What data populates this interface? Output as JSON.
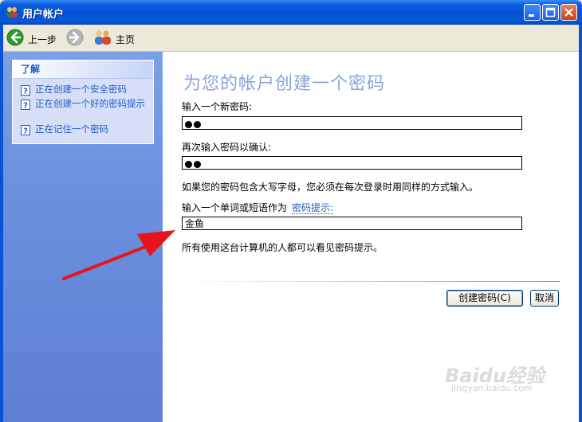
{
  "window": {
    "title": "用户帐户",
    "accent": "#0a53d6"
  },
  "toolbar": {
    "back_label": "上一步",
    "home_label": "主页"
  },
  "sidebar": {
    "heading": "了解",
    "items": [
      {
        "label": "正在创建一个安全密码"
      },
      {
        "label": "正在创建一个好的密码提示"
      },
      {
        "label": "正在记住一个密码"
      }
    ]
  },
  "main": {
    "title": "为您的帐户创建一个密码",
    "new_password_label": "输入一个新密码:",
    "confirm_label": "再次输入密码以确认:",
    "case_note": "如果您的密码包含大写字母，您必须在每次登录时用同样的方式输入。",
    "hint_label": "输入一个单词或短语作为",
    "hint_link": "密码提示:",
    "hint_value": "金鱼",
    "visibility_note": "所有使用这台计算机的人都可以看见密码提示。",
    "create_button": "创建密码(C)",
    "cancel_button": "取消"
  },
  "watermark": {
    "brand": "Baidu经验",
    "url": "jingyan.baidu.com"
  }
}
